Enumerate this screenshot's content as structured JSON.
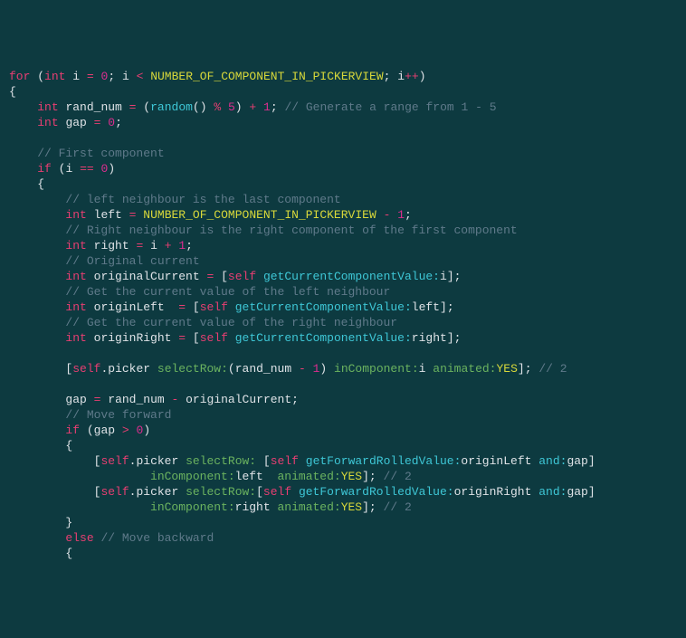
{
  "code": {
    "l1": {
      "for": "for",
      "int1": "int",
      "i1": "i",
      "eq1": "=",
      "z1": "0",
      "semi1": ";",
      "i2": "i",
      "lt": "<",
      "const1": "NUMBER_OF_COMPONENT_IN_PICKERVIEW",
      "semi2": ";",
      "i3": "i",
      "inc": "++",
      "close": ")"
    },
    "l2": {
      "brace": "{"
    },
    "l3": {
      "int": "int",
      "var": "rand_num",
      "eq": "=",
      "lp": "(",
      "fn": "random",
      "rp1": "()",
      "mod": "%",
      "five": "5",
      "rp2": ")",
      "plus": "+",
      "one": "1",
      "semi": ";",
      "comment": "// Generate a range from 1 - 5"
    },
    "l4": {
      "int": "int",
      "var": "gap",
      "eq": "=",
      "zero": "0",
      "semi": ";"
    },
    "l5": {
      "comment": "// First component"
    },
    "l6": {
      "if": "if",
      "lp": "(",
      "i": "i",
      "eq": "==",
      "zero": "0",
      "rp": ")"
    },
    "l7": {
      "brace": "{"
    },
    "l8": {
      "comment": "// left neighbour is the last component"
    },
    "l9": {
      "int": "int",
      "var": "left",
      "eq": "=",
      "const": "NUMBER_OF_COMPONENT_IN_PICKERVIEW",
      "minus": "-",
      "one": "1",
      "semi": ";"
    },
    "l10": {
      "comment": "// Right neighbour is the right component of the first component"
    },
    "l11": {
      "int": "int",
      "var": "right",
      "eq": "=",
      "i": "i",
      "plus": "+",
      "one": "1",
      "semi": ";"
    },
    "l12": {
      "comment": "// Original current"
    },
    "l13": {
      "int": "int",
      "var": "originalCurrent",
      "eq": "=",
      "lb": "[",
      "self": "self",
      "method": "getCurrentComponentValue:",
      "arg": "i",
      "rb": "]",
      "semi": ";"
    },
    "l14": {
      "comment": "// Get the current value of the left neighbour"
    },
    "l15": {
      "int": "int",
      "var": "originLeft",
      "eq": "=",
      "lb": "[",
      "self": "self",
      "method": "getCurrentComponentValue:",
      "arg": "left",
      "rb": "]",
      "semi": ";"
    },
    "l16": {
      "comment": "// Get the current value of the right neighbour"
    },
    "l17": {
      "int": "int",
      "var": "originRight",
      "eq": "=",
      "lb": "[",
      "self": "self",
      "method": "getCurrentComponentValue:",
      "arg": "right",
      "rb": "]",
      "semi": ";"
    },
    "l18": {
      "lb": "[",
      "self": "self",
      "dot": ".",
      "prop": "picker",
      "sel1": "selectRow:",
      "lp": "(",
      "arg1": "rand_num",
      "minus": "-",
      "one": "1",
      "rp": ")",
      "sel2": "inComponent:",
      "arg2": "i",
      "sel3": "animated:",
      "yes": "YES",
      "rb": "]",
      "semi": ";",
      "comment": "// 2"
    },
    "l19": {
      "var": "gap",
      "eq": "=",
      "a": "rand_num",
      "minus": "-",
      "b": "originalCurrent",
      "semi": ";"
    },
    "l20": {
      "comment": "// Move forward"
    },
    "l21": {
      "if": "if",
      "lp": "(",
      "var": "gap",
      "gt": ">",
      "zero": "0",
      "rp": ")"
    },
    "l22": {
      "brace": "{"
    },
    "l23": {
      "lb": "[",
      "self": "self",
      "dot": ".",
      "prop": "picker",
      "sel1": "selectRow:",
      "lb2": "[",
      "self2": "self",
      "method": "getForwardRolledValue:",
      "arg1": "originLeft",
      "and": "and:",
      "arg2": "gap",
      "rb2": "]"
    },
    "l24": {
      "sel2": "inComponent:",
      "arg3": "left",
      "sel3": "animated:",
      "yes": "YES",
      "rb": "]",
      "semi": ";",
      "comment": "// 2"
    },
    "l25": {
      "lb": "[",
      "self": "self",
      "dot": ".",
      "prop": "picker",
      "sel1": "selectRow:",
      "lb2": "[",
      "self2": "self",
      "method": "getForwardRolledValue:",
      "arg1": "originRight",
      "and": "and:",
      "arg2": "gap",
      "rb2": "]"
    },
    "l26": {
      "sel2": "inComponent:",
      "arg3": "right",
      "sel3": "animated:",
      "yes": "YES",
      "rb": "]",
      "semi": ";",
      "comment": "// 2"
    },
    "l27": {
      "brace": "}"
    },
    "l28": {
      "else": "else",
      "comment": "// Move backward"
    },
    "l29": {
      "brace": "{"
    }
  }
}
